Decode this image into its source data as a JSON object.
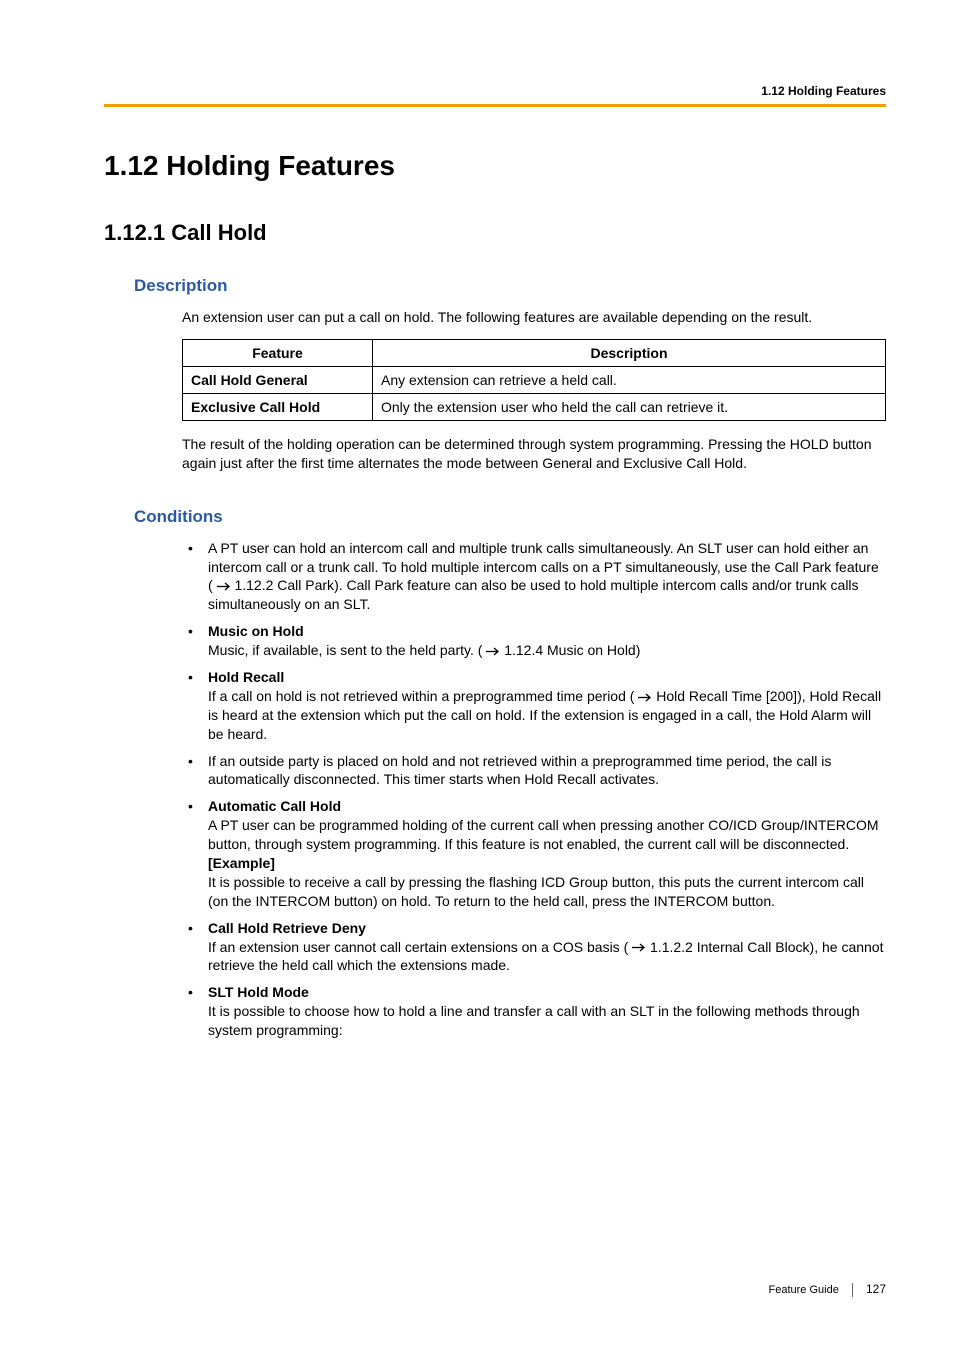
{
  "running_header": "1.12 Holding Features",
  "section_title": "1.12  Holding Features",
  "subsection_title": "1.12.1  Call Hold",
  "description": {
    "heading": "Description",
    "intro": "An extension user can put a call on hold. The following features are available depending on the result.",
    "table": {
      "headers": {
        "feature": "Feature",
        "description": "Description"
      },
      "rows": [
        {
          "feature": "Call Hold General",
          "description": "Any extension can retrieve a held call."
        },
        {
          "feature": "Exclusive Call Hold",
          "description": "Only the extension user who held the call can retrieve it."
        }
      ]
    },
    "after_table": "The result of the holding operation can be determined through system programming. Pressing the HOLD button again just after the first time alternates the mode between General and Exclusive Call Hold."
  },
  "conditions": {
    "heading": "Conditions",
    "items": [
      {
        "plain_pre": "A PT user can hold an intercom call and multiple trunk calls simultaneously. An SLT user can hold either an intercom call or a trunk call. To hold multiple intercom calls on a PT simultaneously, use the Call Park feature (",
        "ref": "1.12.2 Call Park",
        "plain_post": "). Call Park feature can also be used to hold multiple intercom calls and/or trunk calls simultaneously on an SLT."
      },
      {
        "title": "Music on Hold",
        "plain_pre": "Music, if available, is sent to the held party. (",
        "ref": "1.12.4 Music on Hold",
        "plain_post": ")"
      },
      {
        "title": "Hold Recall",
        "plain_pre": "If a call on hold is not retrieved within a preprogrammed time period (",
        "ref": "Hold Recall Time [200]",
        "plain_post": "), Hold Recall is heard at the extension which put the call on hold. If the extension is engaged in a call, the Hold Alarm will be heard."
      },
      {
        "plain_pre": "If an outside party is placed on hold and not retrieved within a preprogrammed time period, the call is automatically disconnected. This timer starts when Hold Recall activates."
      },
      {
        "title": "Automatic Call Hold",
        "body": "A PT user can be programmed holding of the current call when pressing another CO/ICD Group/INTERCOM button, through system programming. If this feature is not enabled, the current call will be disconnected.",
        "example_label": "[Example]",
        "example_body": "It is possible to receive a call by pressing the flashing ICD Group button, this puts the current intercom call (on the INTERCOM button) on hold. To return to the held call, press the INTERCOM button."
      },
      {
        "title": "Call Hold Retrieve Deny",
        "plain_pre": "If an extension user cannot call certain extensions on a COS basis (",
        "ref": "1.1.2.2 Internal Call Block",
        "plain_post": "), he cannot retrieve the held call which the extensions made."
      },
      {
        "title": "SLT Hold Mode",
        "body": "It is possible to choose how to hold a line and transfer a call with an SLT in the following methods through system programming:"
      }
    ]
  },
  "footer": {
    "label": "Feature Guide",
    "page": "127"
  }
}
